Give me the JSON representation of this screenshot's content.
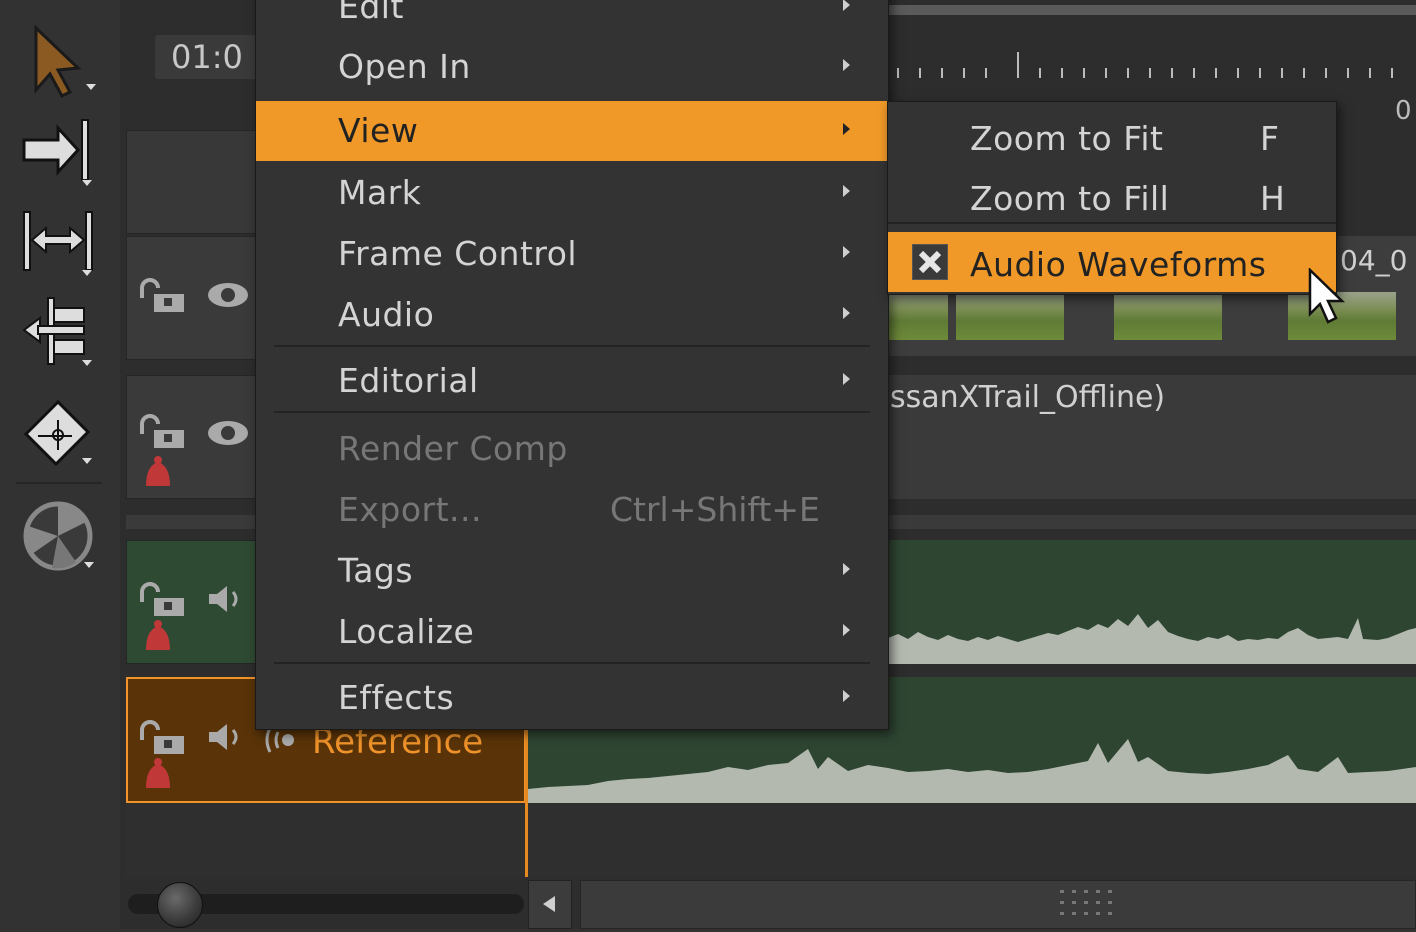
{
  "timecode": "01:0",
  "ruler": {
    "zero_label": "0"
  },
  "tracks": {
    "video_clip_label": "ssanXTrail_Offline)",
    "video_top_clip_label": "04_0",
    "audio_track_2_name": "Reference"
  },
  "context_menu": {
    "items": [
      {
        "label": "Edit",
        "has_submenu": true
      },
      {
        "label": "Open In",
        "has_submenu": true
      },
      {
        "label": "View",
        "has_submenu": true,
        "active": true
      },
      {
        "label": "Mark",
        "has_submenu": true
      },
      {
        "label": "Frame Control",
        "has_submenu": true
      },
      {
        "label": "Audio",
        "has_submenu": true
      },
      {
        "label": "Editorial",
        "has_submenu": true
      },
      {
        "label": "Render Comp",
        "disabled": true
      },
      {
        "label": "Export...",
        "disabled": true,
        "shortcut": "Ctrl+Shift+E"
      },
      {
        "label": "Tags",
        "has_submenu": true
      },
      {
        "label": "Localize",
        "has_submenu": true
      },
      {
        "label": "Effects",
        "has_submenu": true
      }
    ]
  },
  "view_submenu": {
    "items": [
      {
        "label": "Zoom to Fit",
        "shortcut": "F"
      },
      {
        "label": "Zoom to Fill",
        "shortcut": "H"
      },
      {
        "label": "Audio Waveforms",
        "checked": true,
        "active": true
      }
    ]
  },
  "colors": {
    "menu_highlight": "#f09928",
    "selected_track_border": "#f0932a",
    "audio_track_bg": "#2f4a33",
    "waveform": "#b4b9b0"
  }
}
